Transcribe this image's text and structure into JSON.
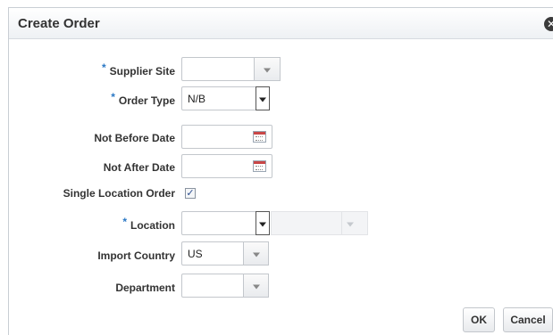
{
  "dialog": {
    "title": "Create Order",
    "close_icon": "close-circle-icon"
  },
  "form": {
    "supplier_site": {
      "label": "Supplier Site",
      "required": "*",
      "value": ""
    },
    "order_type": {
      "label": "Order Type",
      "required": "*",
      "value": "N/B"
    },
    "not_before_date": {
      "label": "Not Before Date",
      "value": "",
      "icon": "calendar-icon"
    },
    "not_after_date": {
      "label": "Not After Date",
      "value": "",
      "icon": "calendar-icon"
    },
    "single_location_order": {
      "label": "Single Location Order",
      "checked": "✓"
    },
    "location": {
      "label": "Location",
      "required": "*",
      "value": ""
    },
    "import_country": {
      "label": "Import Country",
      "value": "US"
    },
    "department": {
      "label": "Department",
      "value": ""
    }
  },
  "buttons": {
    "ok": "OK",
    "cancel": "Cancel"
  }
}
